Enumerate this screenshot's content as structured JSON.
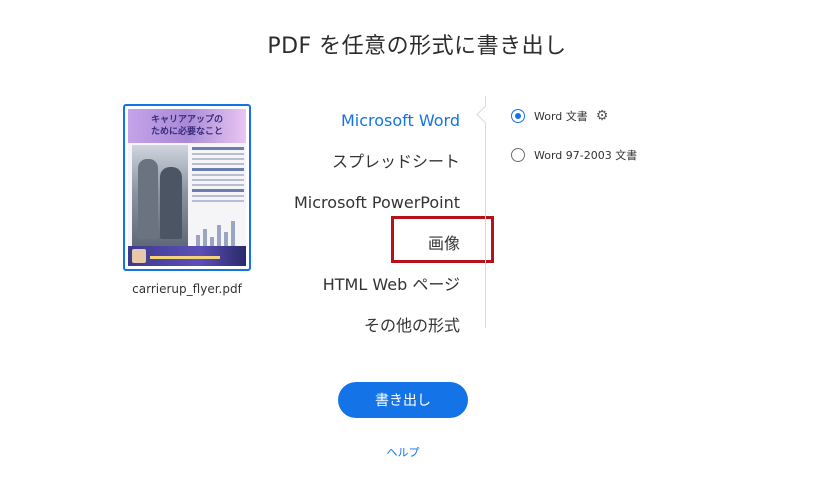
{
  "title": "PDF を任意の形式に書き出し",
  "file": {
    "name": "carrierup_flyer.pdf",
    "thumbnail_heading": "キャリアアップの\nために必要なこと"
  },
  "formats": [
    {
      "label": "Microsoft Word",
      "selected": true
    },
    {
      "label": "スプレッドシート",
      "selected": false
    },
    {
      "label": "Microsoft PowerPoint",
      "selected": false
    },
    {
      "label": "画像",
      "selected": false,
      "highlighted": true
    },
    {
      "label": "HTML Web ページ",
      "selected": false
    },
    {
      "label": "その他の形式",
      "selected": false
    }
  ],
  "options": [
    {
      "label": "Word 文書",
      "checked": true,
      "has_settings": true
    },
    {
      "label": "Word 97-2003 文書",
      "checked": false,
      "has_settings": false
    }
  ],
  "export_button": "書き出し",
  "help_link": "ヘルプ",
  "colors": {
    "accent": "#1473e6",
    "highlight_box": "#b5121b",
    "text": "#333333"
  }
}
